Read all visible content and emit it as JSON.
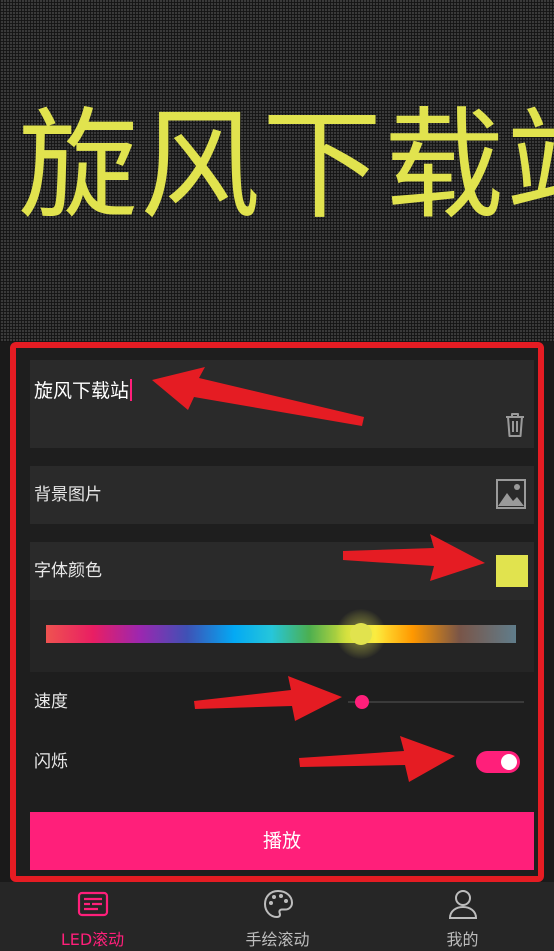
{
  "led_display": {
    "text": "旋风下载站"
  },
  "settings": {
    "text_input": {
      "value": "旋风下载站"
    },
    "background_image": {
      "label": "背景图片"
    },
    "font_color": {
      "label": "字体颜色",
      "value": "#e1e34e",
      "spectrum_position": 0.67
    },
    "speed": {
      "label": "速度",
      "value": 0.08
    },
    "flash": {
      "label": "闪烁",
      "enabled": true
    },
    "play_button": {
      "label": "播放"
    }
  },
  "nav": {
    "items": [
      {
        "label": "LED滚动",
        "icon": "led-board-icon",
        "active": true
      },
      {
        "label": "手绘滚动",
        "icon": "palette-icon",
        "active": false
      },
      {
        "label": "我的",
        "icon": "user-icon",
        "active": false
      }
    ]
  },
  "colors": {
    "accent": "#ff1f7a",
    "highlight": "#e51c23",
    "led_text": "#e1e34e"
  }
}
